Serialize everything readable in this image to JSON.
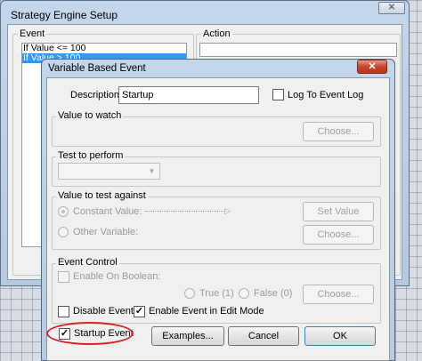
{
  "outer_window": {
    "title": "Strategy Engine Setup",
    "close_glyph": "✕",
    "event_group_label": "Event",
    "action_group_label": "Action",
    "events": [
      "If Value <= 100",
      "If Value > 100"
    ]
  },
  "dialog": {
    "title": "Variable Based Event",
    "close_glyph": "✕",
    "description_label": "Description:",
    "description_value": "Startup",
    "log_to_event_log": "Log To Event Log",
    "value_to_watch": {
      "label": "Value to watch",
      "choose": "Choose..."
    },
    "test_to_perform": {
      "label": "Test to perform",
      "selected": ""
    },
    "value_to_test_against": {
      "label": "Value to test against",
      "constant_value": "Constant Value:",
      "set_value": "Set Value",
      "other_variable": "Other Variable:",
      "choose": "Choose..."
    },
    "event_control": {
      "label": "Event Control",
      "enable_on_boolean": "Enable On Boolean:",
      "true_label": "True (1)",
      "false_label": "False (0)",
      "choose": "Choose..."
    },
    "disable_event": "Disable Event",
    "enable_event_edit_mode": "Enable Event in Edit Mode",
    "startup_event": "Startup Event",
    "examples_button": "Examples...",
    "cancel_button": "Cancel",
    "ok_button": "OK",
    "check_glyph": "✓",
    "arrow_glyph": "▼",
    "arrowhead_glyph": "▷"
  },
  "colors": {
    "selection": "#3399ff",
    "highlight_ring": "#d9201f",
    "close_button": "#c9452b"
  }
}
